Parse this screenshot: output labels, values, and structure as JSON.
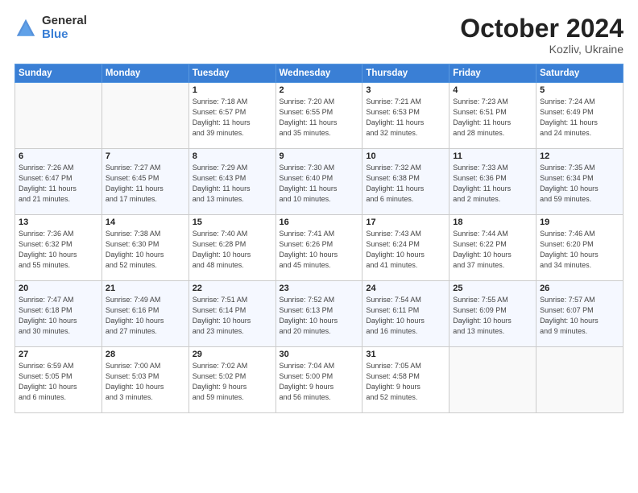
{
  "header": {
    "logo_general": "General",
    "logo_blue": "Blue",
    "month_title": "October 2024",
    "location": "Kozliv, Ukraine"
  },
  "weekdays": [
    "Sunday",
    "Monday",
    "Tuesday",
    "Wednesday",
    "Thursday",
    "Friday",
    "Saturday"
  ],
  "weeks": [
    [
      {
        "day": "",
        "info": ""
      },
      {
        "day": "",
        "info": ""
      },
      {
        "day": "1",
        "info": "Sunrise: 7:18 AM\nSunset: 6:57 PM\nDaylight: 11 hours\nand 39 minutes."
      },
      {
        "day": "2",
        "info": "Sunrise: 7:20 AM\nSunset: 6:55 PM\nDaylight: 11 hours\nand 35 minutes."
      },
      {
        "day": "3",
        "info": "Sunrise: 7:21 AM\nSunset: 6:53 PM\nDaylight: 11 hours\nand 32 minutes."
      },
      {
        "day": "4",
        "info": "Sunrise: 7:23 AM\nSunset: 6:51 PM\nDaylight: 11 hours\nand 28 minutes."
      },
      {
        "day": "5",
        "info": "Sunrise: 7:24 AM\nSunset: 6:49 PM\nDaylight: 11 hours\nand 24 minutes."
      }
    ],
    [
      {
        "day": "6",
        "info": "Sunrise: 7:26 AM\nSunset: 6:47 PM\nDaylight: 11 hours\nand 21 minutes."
      },
      {
        "day": "7",
        "info": "Sunrise: 7:27 AM\nSunset: 6:45 PM\nDaylight: 11 hours\nand 17 minutes."
      },
      {
        "day": "8",
        "info": "Sunrise: 7:29 AM\nSunset: 6:43 PM\nDaylight: 11 hours\nand 13 minutes."
      },
      {
        "day": "9",
        "info": "Sunrise: 7:30 AM\nSunset: 6:40 PM\nDaylight: 11 hours\nand 10 minutes."
      },
      {
        "day": "10",
        "info": "Sunrise: 7:32 AM\nSunset: 6:38 PM\nDaylight: 11 hours\nand 6 minutes."
      },
      {
        "day": "11",
        "info": "Sunrise: 7:33 AM\nSunset: 6:36 PM\nDaylight: 11 hours\nand 2 minutes."
      },
      {
        "day": "12",
        "info": "Sunrise: 7:35 AM\nSunset: 6:34 PM\nDaylight: 10 hours\nand 59 minutes."
      }
    ],
    [
      {
        "day": "13",
        "info": "Sunrise: 7:36 AM\nSunset: 6:32 PM\nDaylight: 10 hours\nand 55 minutes."
      },
      {
        "day": "14",
        "info": "Sunrise: 7:38 AM\nSunset: 6:30 PM\nDaylight: 10 hours\nand 52 minutes."
      },
      {
        "day": "15",
        "info": "Sunrise: 7:40 AM\nSunset: 6:28 PM\nDaylight: 10 hours\nand 48 minutes."
      },
      {
        "day": "16",
        "info": "Sunrise: 7:41 AM\nSunset: 6:26 PM\nDaylight: 10 hours\nand 45 minutes."
      },
      {
        "day": "17",
        "info": "Sunrise: 7:43 AM\nSunset: 6:24 PM\nDaylight: 10 hours\nand 41 minutes."
      },
      {
        "day": "18",
        "info": "Sunrise: 7:44 AM\nSunset: 6:22 PM\nDaylight: 10 hours\nand 37 minutes."
      },
      {
        "day": "19",
        "info": "Sunrise: 7:46 AM\nSunset: 6:20 PM\nDaylight: 10 hours\nand 34 minutes."
      }
    ],
    [
      {
        "day": "20",
        "info": "Sunrise: 7:47 AM\nSunset: 6:18 PM\nDaylight: 10 hours\nand 30 minutes."
      },
      {
        "day": "21",
        "info": "Sunrise: 7:49 AM\nSunset: 6:16 PM\nDaylight: 10 hours\nand 27 minutes."
      },
      {
        "day": "22",
        "info": "Sunrise: 7:51 AM\nSunset: 6:14 PM\nDaylight: 10 hours\nand 23 minutes."
      },
      {
        "day": "23",
        "info": "Sunrise: 7:52 AM\nSunset: 6:13 PM\nDaylight: 10 hours\nand 20 minutes."
      },
      {
        "day": "24",
        "info": "Sunrise: 7:54 AM\nSunset: 6:11 PM\nDaylight: 10 hours\nand 16 minutes."
      },
      {
        "day": "25",
        "info": "Sunrise: 7:55 AM\nSunset: 6:09 PM\nDaylight: 10 hours\nand 13 minutes."
      },
      {
        "day": "26",
        "info": "Sunrise: 7:57 AM\nSunset: 6:07 PM\nDaylight: 10 hours\nand 9 minutes."
      }
    ],
    [
      {
        "day": "27",
        "info": "Sunrise: 6:59 AM\nSunset: 5:05 PM\nDaylight: 10 hours\nand 6 minutes."
      },
      {
        "day": "28",
        "info": "Sunrise: 7:00 AM\nSunset: 5:03 PM\nDaylight: 10 hours\nand 3 minutes."
      },
      {
        "day": "29",
        "info": "Sunrise: 7:02 AM\nSunset: 5:02 PM\nDaylight: 9 hours\nand 59 minutes."
      },
      {
        "day": "30",
        "info": "Sunrise: 7:04 AM\nSunset: 5:00 PM\nDaylight: 9 hours\nand 56 minutes."
      },
      {
        "day": "31",
        "info": "Sunrise: 7:05 AM\nSunset: 4:58 PM\nDaylight: 9 hours\nand 52 minutes."
      },
      {
        "day": "",
        "info": ""
      },
      {
        "day": "",
        "info": ""
      }
    ]
  ]
}
